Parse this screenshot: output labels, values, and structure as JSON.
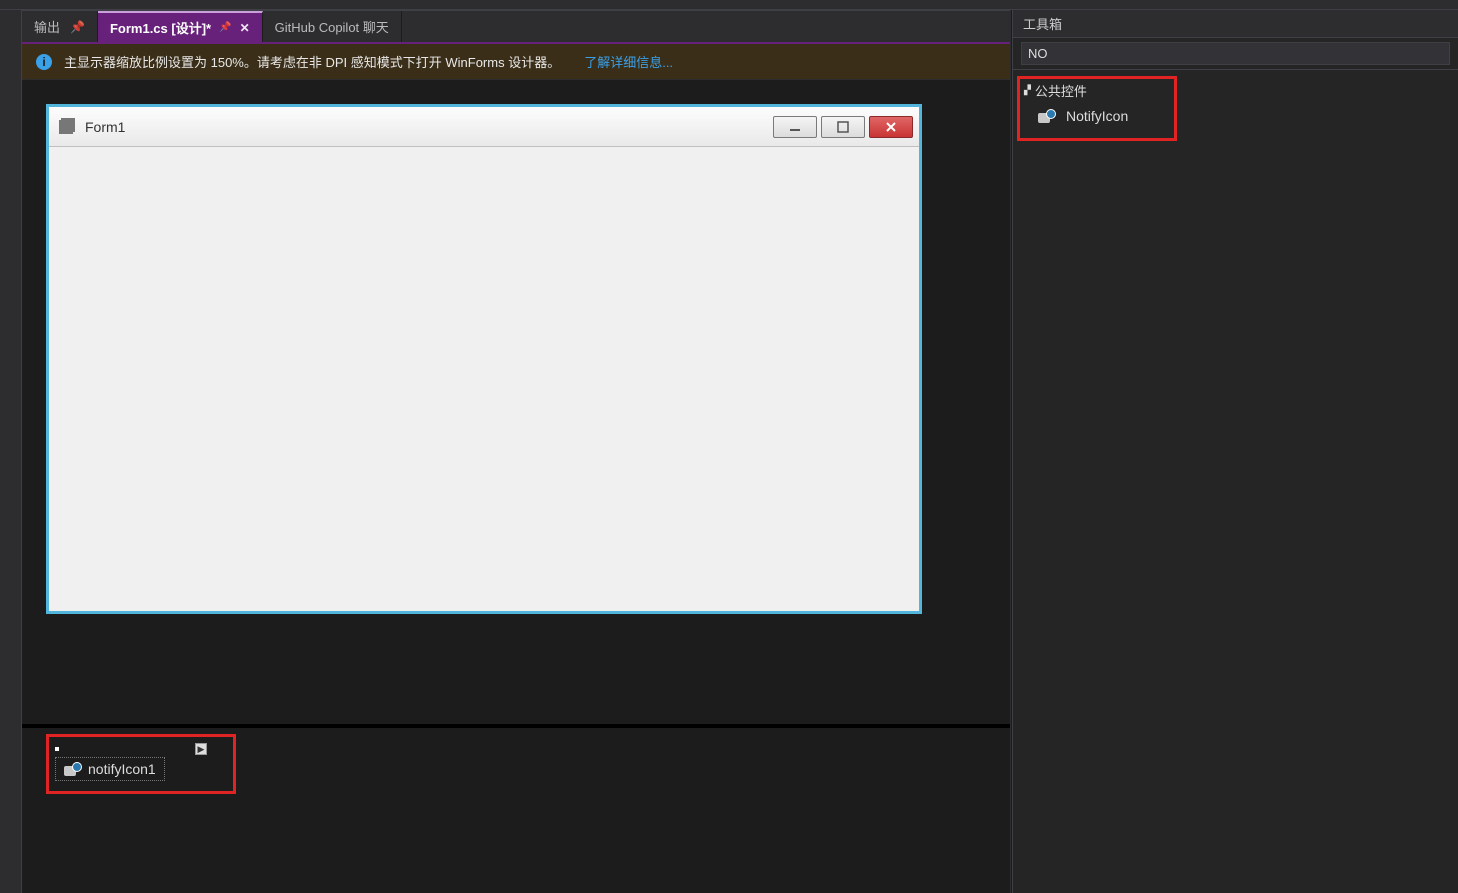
{
  "tabs": {
    "output": {
      "label": "输出"
    },
    "active": {
      "label": "Form1.cs [设计]*"
    },
    "copilot": {
      "label": "GitHub Copilot 聊天"
    }
  },
  "notification": {
    "text": "主显示器缩放比例设置为 150%。请考虑在非 DPI 感知模式下打开 WinForms 设计器。",
    "link": "了解详细信息..."
  },
  "designer": {
    "form_title": "Form1"
  },
  "component_tray": {
    "item_label": "notifyIcon1"
  },
  "toolbox": {
    "title": "工具箱",
    "search_value": "NO",
    "group_label": "公共控件",
    "item_label": "NotifyIcon"
  }
}
